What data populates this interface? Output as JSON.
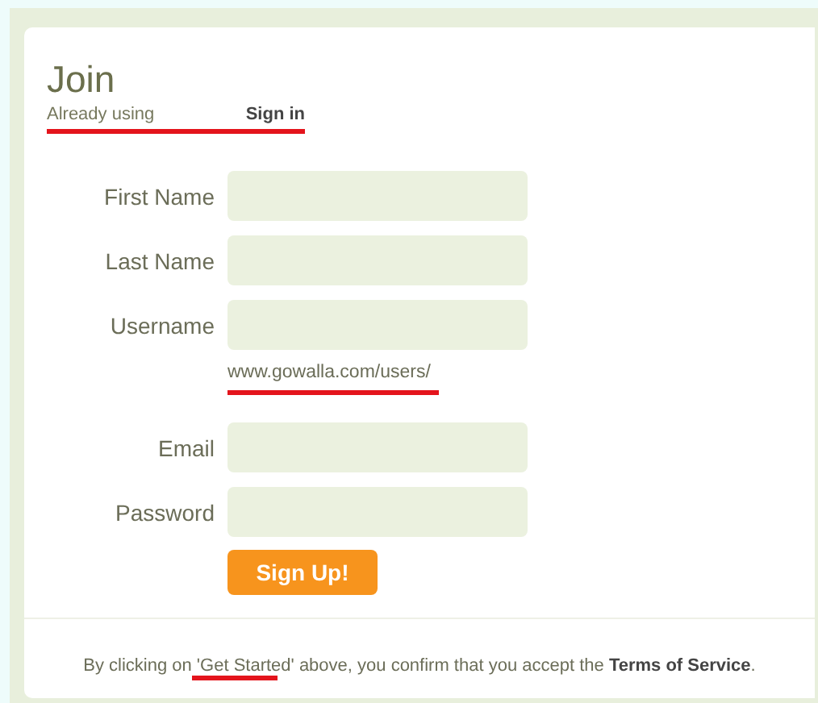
{
  "title": "Join",
  "signin": {
    "prefix": "Already using",
    "link": "Sign in"
  },
  "fields_top": [
    {
      "label": "First Name"
    },
    {
      "label": "Last Name"
    },
    {
      "label": "Username"
    }
  ],
  "username_hint": "www.gowalla.com/users/",
  "fields_bottom": [
    {
      "label": "Email"
    },
    {
      "label": "Password"
    }
  ],
  "submit": "Sign Up!",
  "footer": "By clicking on 'Get Started' above, you confirm that you accept the **Terms of Service**."
}
